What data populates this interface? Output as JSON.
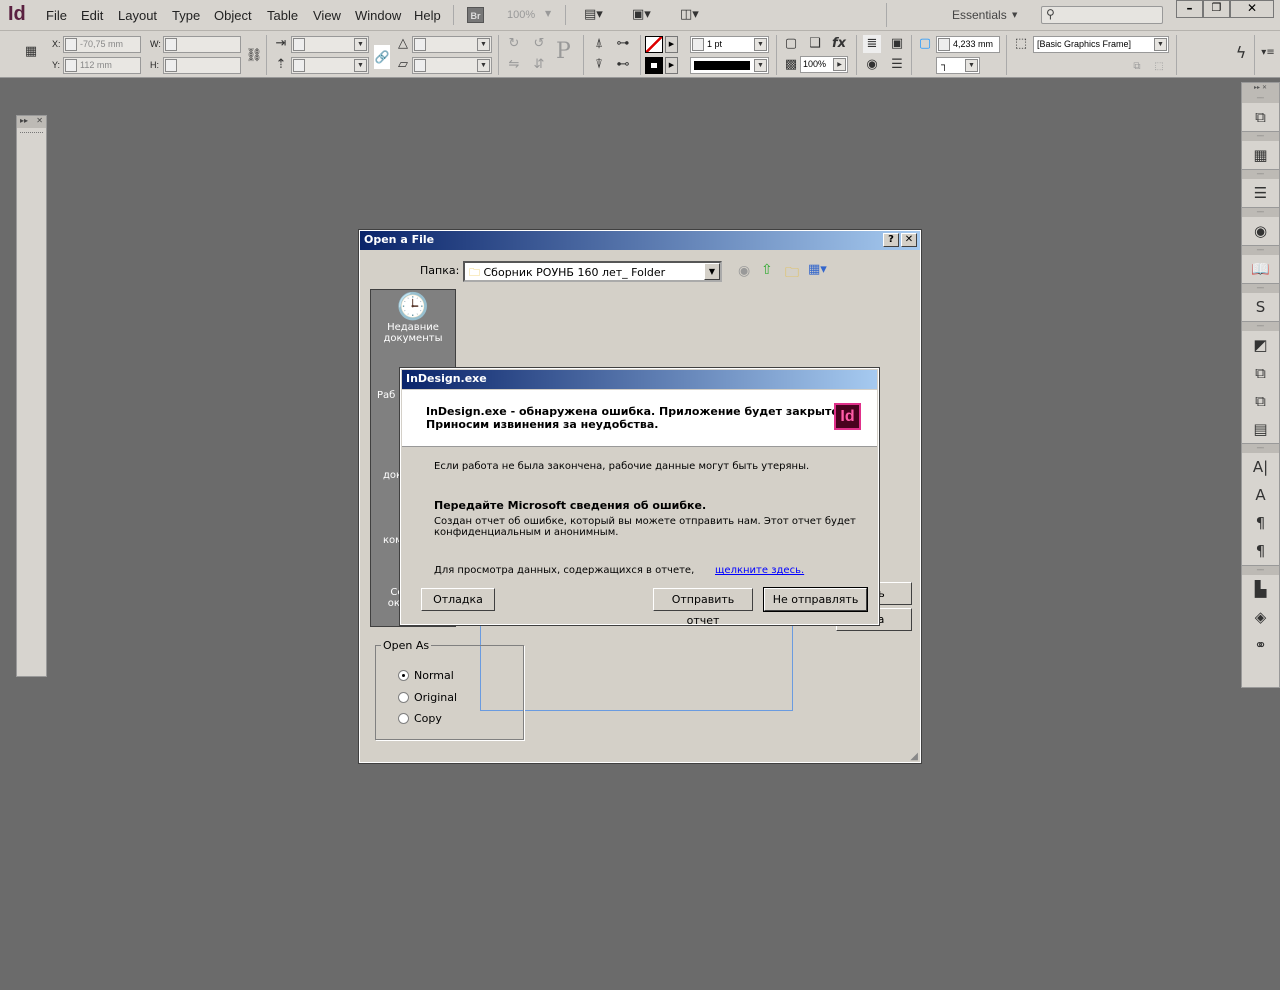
{
  "app": {
    "logo": "Id",
    "menu": [
      "File",
      "Edit",
      "Layout",
      "Type",
      "Object",
      "Table",
      "View",
      "Window",
      "Help"
    ],
    "bridge": "Br",
    "zoom": "100%",
    "workspace": "Essentials",
    "search_placeholder": ""
  },
  "control": {
    "x_label": "X:",
    "x": "-70,75 mm",
    "y_label": "Y:",
    "y": "112 mm",
    "w_label": "W:",
    "h_label": "H:",
    "stroke_weight": "1 pt",
    "opacity": "100%",
    "offset": "4,233 mm",
    "object_style": "[Basic Graphics Frame]",
    "reference_point": "P"
  },
  "open_dialog": {
    "title": "Open a File",
    "help": "?",
    "close": "✕",
    "folder_label": "Папка:",
    "folder": "Сборник РОУНБ 160 лет_ Folder",
    "places": [
      {
        "label": "Недавние документы"
      },
      {
        "label": "Раб"
      },
      {
        "label": "док"
      },
      {
        "label": "ком"
      },
      {
        "label": "Се окр"
      }
    ],
    "open_btn": "ыть",
    "cancel_btn": "ена",
    "open_as": {
      "legend": "Open As",
      "options": [
        {
          "label": "Normal",
          "checked": true
        },
        {
          "label": "Original",
          "checked": false
        },
        {
          "label": "Copy",
          "checked": false
        }
      ]
    }
  },
  "crash_dialog": {
    "title": "InDesign.exe",
    "icon": "Id",
    "header": "InDesign.exe - обнаружена ошибка. Приложение будет закрыто.",
    "header2": "Приносим извинения за неудобства.",
    "warning": "Если работа не была закончена, рабочие данные могут быть утеряны.",
    "send_title": "Передайте Microsoft сведения об ошибке.",
    "send_text": "Создан отчет об ошибке, который вы можете отправить нам. Этот отчет будет",
    "send_text2": "конфиденциальным и анонимным.",
    "view_text": "Для просмотра данных, содержащихся в отчете,",
    "view_link": "щелкните здесь.",
    "debug_btn": "Отладка",
    "send_btn": "Отправить отчет",
    "dont_send_btn": "Не отправлять"
  },
  "colors": {
    "accent": "#0a246a",
    "link": "#0000ff",
    "id_pink": "#e0308a"
  }
}
